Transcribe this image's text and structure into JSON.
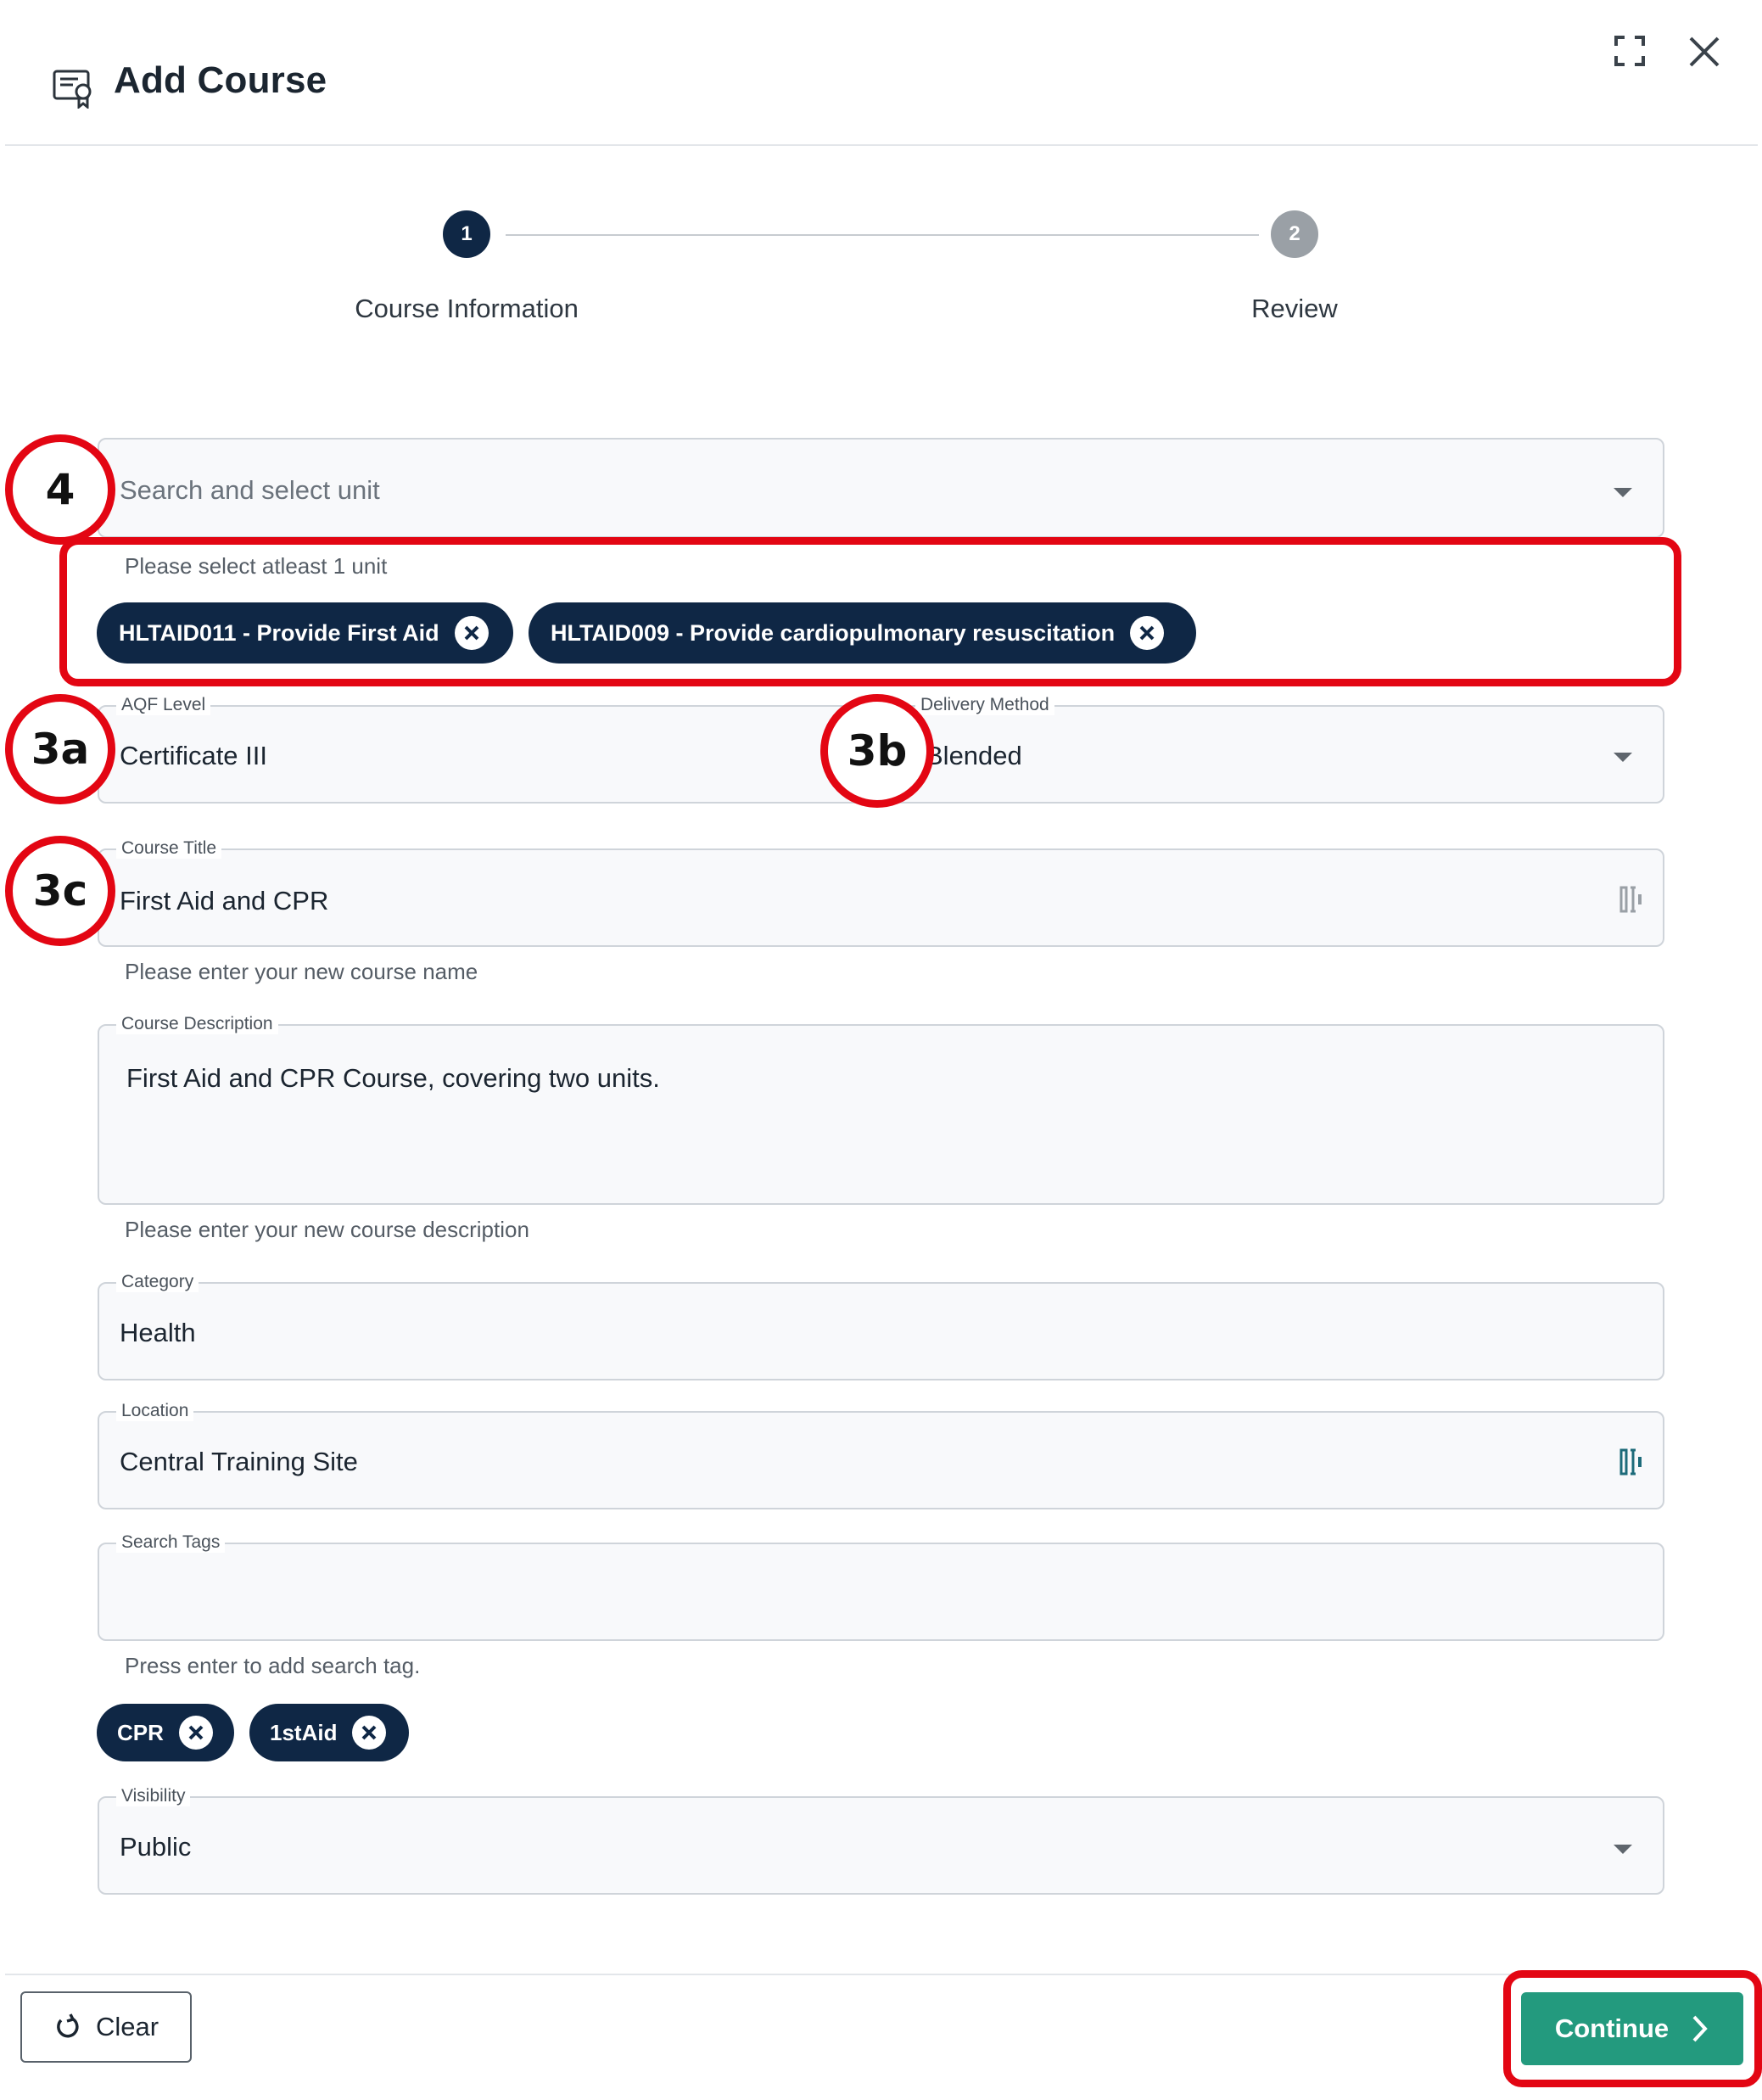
{
  "header": {
    "title": "Add Course"
  },
  "stepper": {
    "steps": [
      {
        "number": "1",
        "label": "Course Information"
      },
      {
        "number": "2",
        "label": "Review"
      }
    ]
  },
  "units": {
    "placeholder": "Search and select unit",
    "helper": "Please select atleast 1 unit",
    "selected": [
      {
        "label": "HLTAID011 - Provide First Aid"
      },
      {
        "label": "HLTAID009 - Provide cardiopulmonary resuscitation"
      }
    ]
  },
  "aqf": {
    "label": "AQF Level",
    "value": "Certificate III"
  },
  "delivery": {
    "label": "Delivery Method",
    "value": "Blended"
  },
  "course_title": {
    "label": "Course Title",
    "value": "First Aid and CPR",
    "helper": "Please enter your new course name"
  },
  "course_description": {
    "label": "Course Description",
    "value": "First Aid and CPR Course, covering two units.",
    "helper": "Please enter your new course description"
  },
  "category": {
    "label": "Category",
    "value": "Health"
  },
  "location": {
    "label": "Location",
    "value": "Central Training Site"
  },
  "search_tags": {
    "label": "Search Tags",
    "value": "",
    "helper": "Press enter to add search tag.",
    "tags": [
      "CPR",
      "1stAid"
    ]
  },
  "visibility": {
    "label": "Visibility",
    "value": "Public"
  },
  "footer": {
    "clear_label": "Clear",
    "continue_label": "Continue"
  },
  "annotations": {
    "a4": "4",
    "a3a": "3a",
    "a3b": "3b",
    "a3c": "3c"
  },
  "colors": {
    "primary": "#0f2745",
    "accent": "#239a7e",
    "annotation": "#e30613"
  }
}
